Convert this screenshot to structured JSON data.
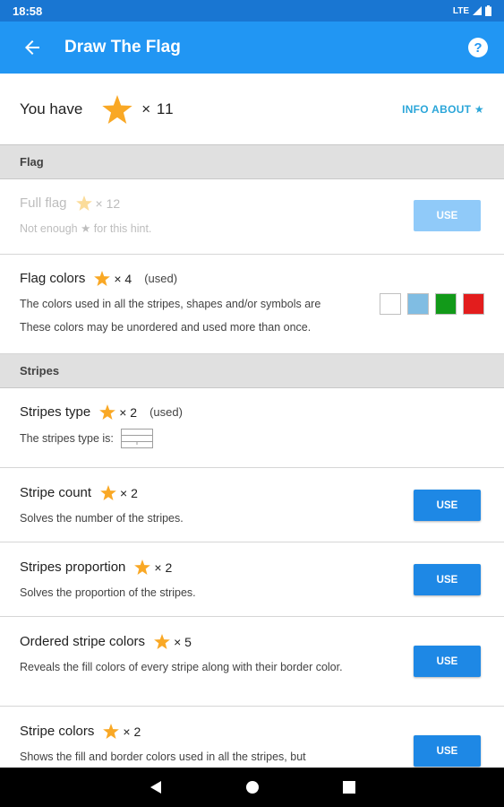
{
  "status_bar": {
    "time": "18:58",
    "network": "LTE"
  },
  "app_bar": {
    "title": "Draw The Flag",
    "help_label": "?"
  },
  "balance": {
    "label": "You have",
    "count": "× 11",
    "info_label": "INFO ABOUT ★"
  },
  "colors": {
    "primary": "#2196f3",
    "status": "#1976d2",
    "star": "#f9a825",
    "button": "#1e88e5",
    "link": "#2ba6d9"
  },
  "sections": {
    "flag": "Flag",
    "stripes": "Stripes"
  },
  "hints": {
    "full_flag": {
      "name": "Full flag",
      "cost": "× 12",
      "desc": "Not enough ★ for this hint.",
      "button": "USE"
    },
    "flag_colors": {
      "name": "Flag colors",
      "cost": "× 4",
      "status": "(used)",
      "desc1": "The colors used in all the stripes, shapes and/or symbols are",
      "desc2": "These colors may be unordered and used more than once.",
      "swatches": [
        "#ffffff",
        "#80bde3",
        "#129a19",
        "#e31d1d"
      ]
    },
    "stripes_type": {
      "name": "Stripes type",
      "cost": "× 2",
      "status": "(used)",
      "desc": "The stripes type is:"
    },
    "stripe_count": {
      "name": "Stripe count",
      "cost": "× 2",
      "desc": "Solves the number of the stripes.",
      "button": "USE"
    },
    "stripes_proportion": {
      "name": "Stripes proportion",
      "cost": "× 2",
      "desc": "Solves the proportion of the stripes.",
      "button": "USE"
    },
    "ordered_stripe_colors": {
      "name": "Ordered stripe colors",
      "cost": "× 5",
      "desc": "Reveals the fill colors of every stripe along with their border color.",
      "button": "USE"
    },
    "stripe_colors": {
      "name": "Stripe colors",
      "cost": "× 2",
      "desc": "Shows the fill and border colors used in all the stripes, but",
      "button": "USE"
    }
  },
  "nav": {
    "back_icon": "triangle-back-icon",
    "home_icon": "circle-home-icon",
    "recents_icon": "square-recents-icon"
  }
}
